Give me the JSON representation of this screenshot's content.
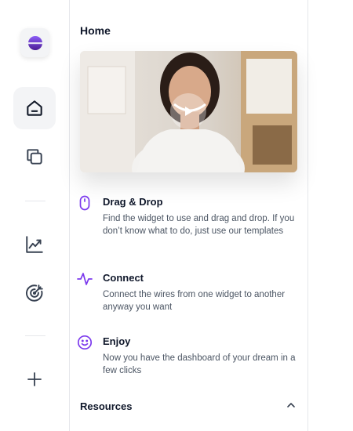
{
  "panel": {
    "title": "Home"
  },
  "features": [
    {
      "icon": "mouse-icon",
      "title": "Drag & Drop",
      "description": "Find the widget to use and drag and drop. If you don’t know what to do, just use our templates"
    },
    {
      "icon": "activity-icon",
      "title": "Connect",
      "description": "Connect the wires from one widget to another anyway you want"
    },
    {
      "icon": "smile-icon",
      "title": "Enjoy",
      "description": "Now you have the dashboard of your dream in a few clicks"
    }
  ],
  "resources": {
    "label": "Resources"
  },
  "colors": {
    "accent": "#7c3aed",
    "rail_active_bg": "#f3f4f6",
    "text_primary": "#0f172a",
    "text_secondary": "#4b5563"
  },
  "rail": {
    "icons": [
      "logo-icon",
      "home-icon",
      "copy-icon",
      "chart-trend-icon",
      "target-icon",
      "plus-icon"
    ]
  }
}
